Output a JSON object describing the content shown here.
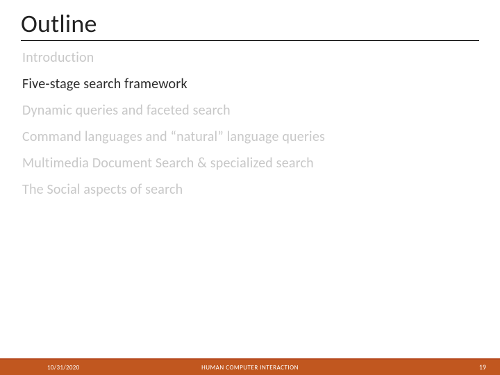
{
  "title": "Outline",
  "items": [
    {
      "label": "Introduction",
      "current": false
    },
    {
      "label": "Five-stage search framework",
      "current": true
    },
    {
      "label": "Dynamic queries and faceted search",
      "current": false
    },
    {
      "label": "Command languages and “natural” language queries",
      "current": false
    },
    {
      "label": "Multimedia Document Search & specialized search",
      "current": false
    },
    {
      "label": "The Social aspects of search",
      "current": false
    }
  ],
  "footer": {
    "date": "10/31/2020",
    "center": "HUMAN COMPUTER INTERACTION",
    "page": "19"
  },
  "colors": {
    "accent": "#c1571f",
    "muted_text": "#c8c8c8",
    "body_text": "#2b2b2b"
  }
}
